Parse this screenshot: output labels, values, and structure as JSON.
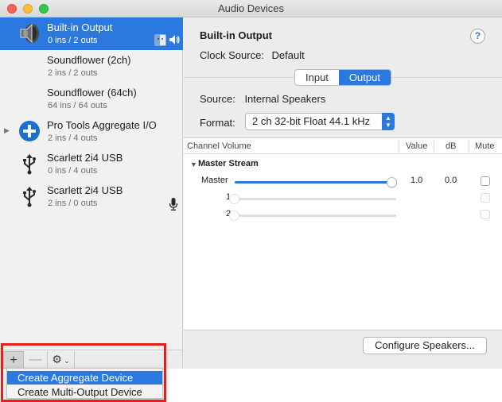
{
  "window": {
    "title": "Audio Devices"
  },
  "devices": [
    {
      "name": "Built-in Output",
      "io": "0 ins / 2 outs",
      "icon": "speaker-icon",
      "selected": true
    },
    {
      "name": "Soundflower (2ch)",
      "io": "2 ins / 2 outs",
      "icon": "none",
      "selected": false
    },
    {
      "name": "Soundflower (64ch)",
      "io": "64 ins / 64 outs",
      "icon": "none",
      "selected": false
    },
    {
      "name": "Pro Tools Aggregate I/O",
      "io": "2 ins / 4 outs",
      "icon": "aggregate-plus-icon",
      "selected": false
    },
    {
      "name": "Scarlett 2i4 USB",
      "io": "0 ins / 4 outs",
      "icon": "usb-icon",
      "selected": false
    },
    {
      "name": "Scarlett 2i4 USB",
      "io": "2 ins / 0 outs",
      "icon": "usb-icon",
      "selected": false
    }
  ],
  "toolbar": {
    "add": "+",
    "remove": "—",
    "gear": "⚙"
  },
  "popup_menu": {
    "items": [
      "Create Aggregate Device",
      "Create Multi-Output Device"
    ],
    "highlighted_index": 0
  },
  "detail": {
    "title": "Built-in Output",
    "clock_source_label": "Clock Source:",
    "clock_source_value": "Default",
    "help": "?",
    "tabs": [
      "Input",
      "Output"
    ],
    "active_tab": "Output",
    "source_label": "Source:",
    "source_value": "Internal Speakers",
    "format_label": "Format:",
    "format_value": "2 ch 32-bit Float 44.1 kHz",
    "table": {
      "headers": [
        "Channel Volume",
        "Value",
        "dB",
        "Mute"
      ],
      "stream_title": "Master Stream",
      "channels": [
        {
          "name": "Master",
          "value": "1.0",
          "db": "0.0",
          "level": 1.0,
          "enabled": true
        },
        {
          "name": "1",
          "value": "",
          "db": "",
          "level": 0.0,
          "enabled": false
        },
        {
          "name": "2",
          "value": "",
          "db": "",
          "level": 0.0,
          "enabled": false
        }
      ]
    },
    "configure_button": "Configure Speakers..."
  },
  "colors": {
    "accent": "#2b78df",
    "highlight_box": "#e5201c"
  }
}
